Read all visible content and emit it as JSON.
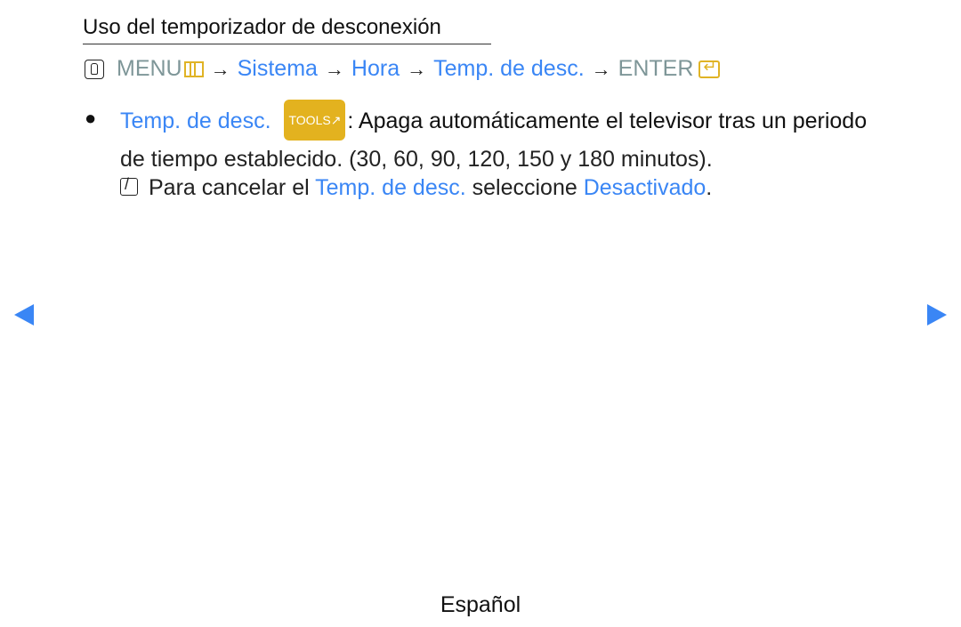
{
  "title": "Uso del temporizador de desconexión",
  "path": {
    "menu": "MENU",
    "items": [
      "Sistema",
      "Hora",
      "Temp. de desc."
    ],
    "enter": "ENTER",
    "arrow": "→"
  },
  "item": {
    "bullet": "●",
    "name": "Temp. de desc.",
    "tools_label": "TOOLS",
    "tools_glyph": "↗",
    "description_line1": ": Apaga automáticamente el televisor tras un periodo",
    "description_line2": "de tiempo establecido. (30, 60, 90, 120, 150 y 180 minutos)."
  },
  "note": {
    "prefix": "Para cancelar el ",
    "link1": "Temp. de desc.",
    "middle": " seleccione ",
    "link2": "Desactivado",
    "suffix": "."
  },
  "footer": {
    "language": "Español"
  },
  "colors": {
    "link_blue": "#3a86f5",
    "menu_grey": "#7e9698",
    "icon_yellow": "#e0b325"
  }
}
